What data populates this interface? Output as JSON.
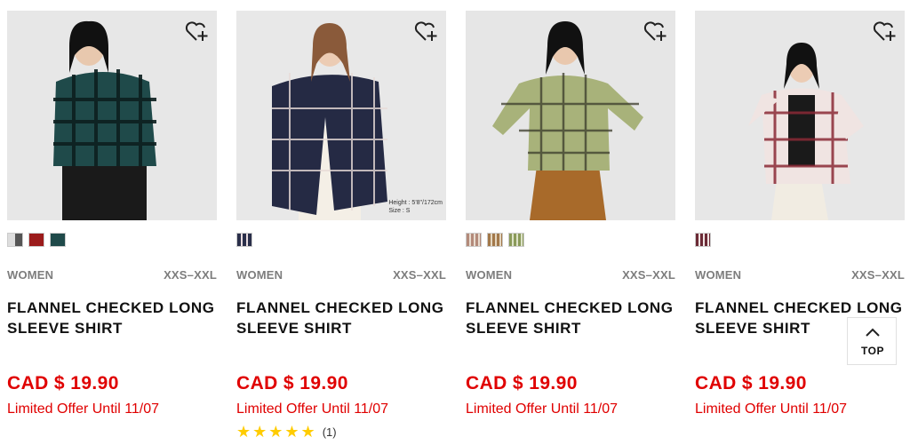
{
  "products": [
    {
      "gender": "WOMEN",
      "sizes": "XXS–XXL",
      "title_line1": "FLANNEL CHECKED LONG",
      "title_line2": "SLEEVE SHIRT",
      "price": "CAD $ 19.90",
      "offer": "Limited Offer Until 11/07",
      "swatches": [
        "#8a8a8a",
        "#9b1b1b",
        "#1f4a4a"
      ],
      "favorite_icon": "heart-plus-icon"
    },
    {
      "gender": "WOMEN",
      "sizes": "XXS–XXL",
      "title_line1": "FLANNEL CHECKED LONG",
      "title_line2": "SLEEVE SHIRT",
      "price": "CAD $ 19.90",
      "offer": "Limited Offer Until 11/07",
      "swatches": [
        "#2a2f4a"
      ],
      "height_note_line1": "Height : 5'8\"/172cm",
      "height_note_line2": "Size : S",
      "rating_stars": 5,
      "rating_count": "(1)",
      "favorite_icon": "heart-plus-icon"
    },
    {
      "gender": "WOMEN",
      "sizes": "XXS–XXL",
      "title_line1": "FLANNEL CHECKED LONG",
      "title_line2": "SLEEVE SHIRT",
      "price": "CAD $ 19.90",
      "offer": "Limited Offer Until 11/07",
      "swatches": [
        "#b38a7a",
        "#a2784a",
        "#8a9a5a"
      ],
      "favorite_icon": "heart-plus-icon"
    },
    {
      "gender": "WOMEN",
      "sizes": "XXS–XXL",
      "title_line1": "FLANNEL CHECKED LONG",
      "title_line2": "SLEEVE SHIRT",
      "price": "CAD $ 19.90",
      "offer": "Limited Offer Until 11/07",
      "swatches": [
        "#6b2a36"
      ],
      "favorite_icon": "heart-plus-icon"
    }
  ],
  "back_to_top": {
    "label": "TOP",
    "icon": "chevron-up-icon"
  },
  "colors": {
    "price_red": "#e00000",
    "meta_gray": "#7d7d7d",
    "star_yellow": "#ffcc00"
  }
}
